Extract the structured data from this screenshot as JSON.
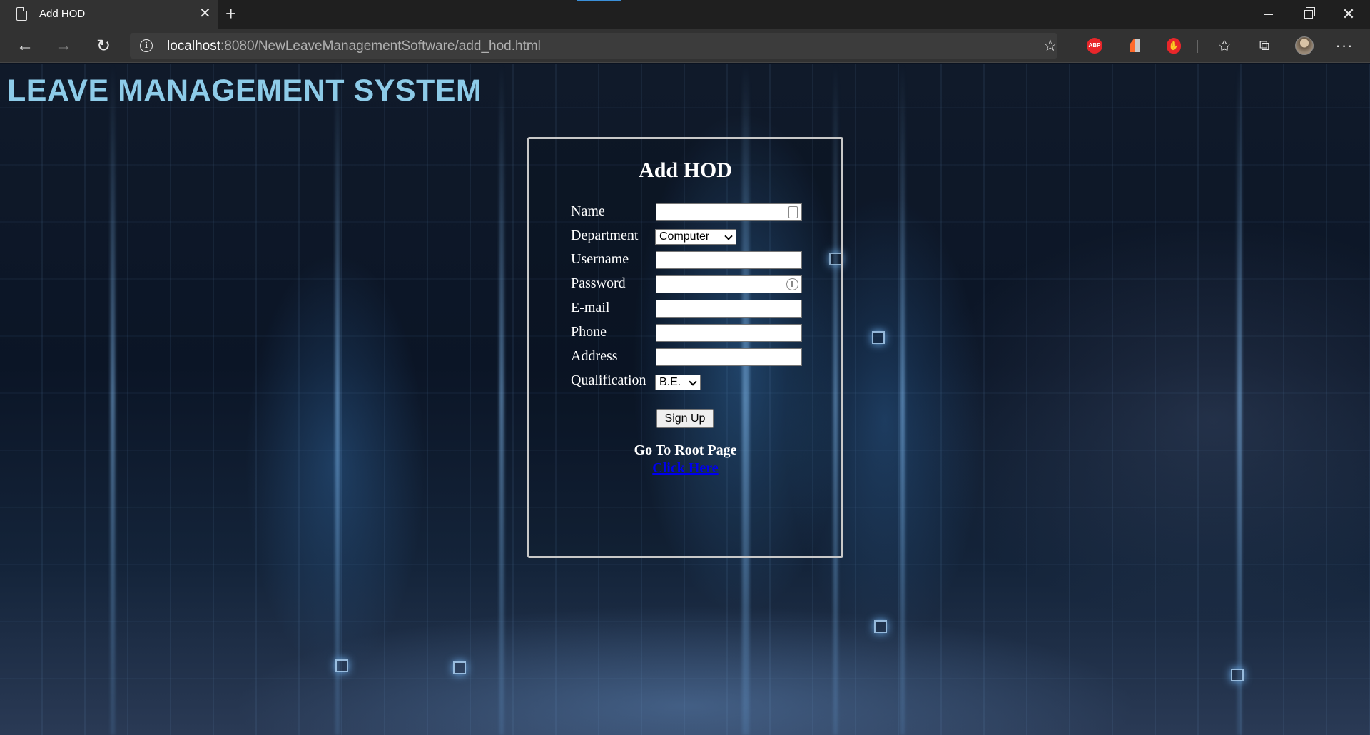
{
  "browser": {
    "tab_title": "Add HOD",
    "url_host": "localhost",
    "url_rest": ":8080/NewLeaveManagementSoftware/add_hod.html",
    "extensions": {
      "abp_label": "ABP"
    }
  },
  "page": {
    "site_title": "LEAVE MANAGEMENT SYSTEM",
    "form": {
      "heading": "Add HOD",
      "labels": {
        "name": "Name",
        "department": "Department",
        "username": "Username",
        "password": "Password",
        "email": "E-mail",
        "phone": "Phone",
        "address": "Address",
        "qualification": "Qualification"
      },
      "values": {
        "name": "",
        "department": "Computer",
        "username": "",
        "password": "",
        "email": "",
        "phone": "",
        "address": "",
        "qualification": "B.E."
      },
      "submit_label": "Sign Up",
      "root_text": "Go To Root Page",
      "root_link": "Click Here"
    }
  },
  "colors": {
    "site_title": "#8dcbe8",
    "link": "#0000ee",
    "form_border": "#c8c8c8"
  }
}
